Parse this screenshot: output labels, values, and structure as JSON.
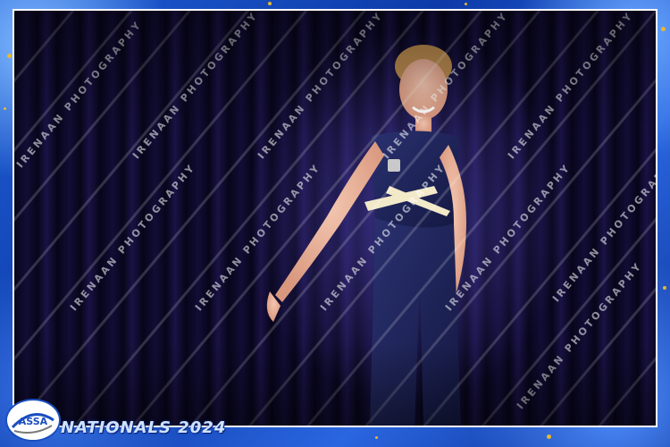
{
  "photo": {
    "description": "Young gymnast in navy leotard with white and gold diagonal stripe posing on stage in front of dark curtain"
  },
  "watermark": {
    "text": "IRENAAN PHOTOGRAPHY"
  },
  "branding": {
    "logo_text": "ASSA",
    "event_title": "NATIONALS 2024"
  },
  "colors": {
    "frame_blue": "#1f5fd6",
    "curtain": "#07051a",
    "leotard": "#1b2150",
    "gold_accent": "#e6b832"
  }
}
